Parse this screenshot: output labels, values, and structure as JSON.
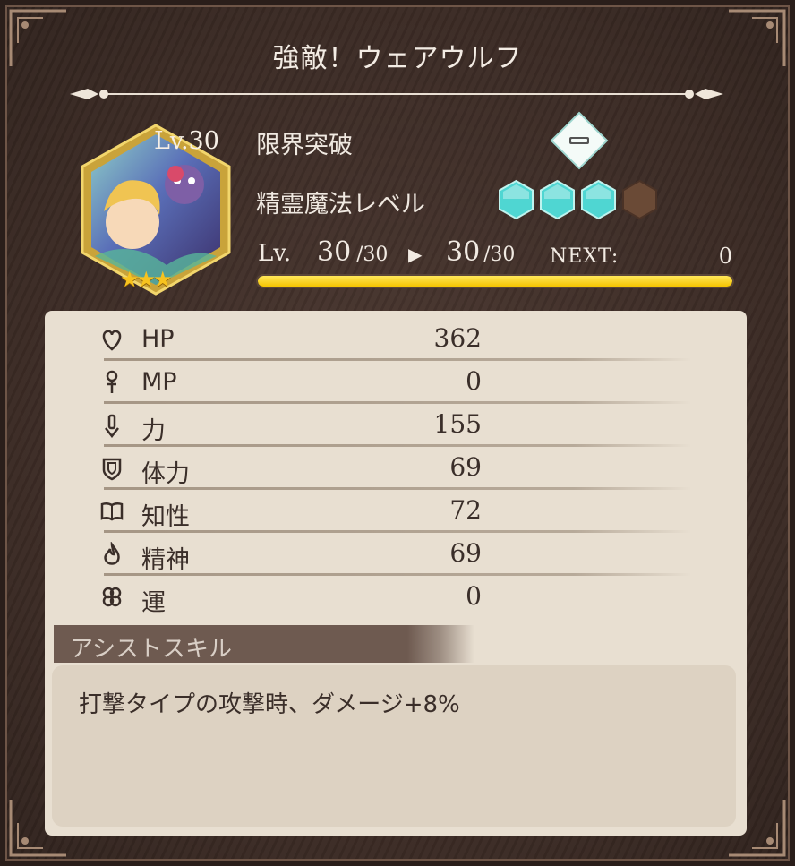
{
  "title": "強敵！ウェアウルフ",
  "character": {
    "level_badge": "Lv.30",
    "stars": "★★★",
    "limit_break_label": "限界突破",
    "limit_break_icon": "minus-diamond-icon",
    "spirit_magic_label": "精霊魔法レベル",
    "spirit_magic_level": 3,
    "spirit_magic_max": 4
  },
  "level": {
    "label": "Lv.",
    "current": "30",
    "current_max": "/30",
    "new": "30",
    "new_max": "/30",
    "next_label": "NEXT:",
    "next_value": "0",
    "progress": 1.0
  },
  "stats": [
    {
      "icon": "heart-icon",
      "name": "HP",
      "value": "362"
    },
    {
      "icon": "mp-staff-icon",
      "name": "MP",
      "value": "0"
    },
    {
      "icon": "power-icon",
      "name": "力",
      "value": "155"
    },
    {
      "icon": "shield-icon",
      "name": "体力",
      "value": "69"
    },
    {
      "icon": "book-icon",
      "name": "知性",
      "value": "72"
    },
    {
      "icon": "spirit-flame-icon",
      "name": "精神",
      "value": "69"
    },
    {
      "icon": "clover-icon",
      "name": "運",
      "value": "0"
    }
  ],
  "assist_skill": {
    "title": "アシストスキル",
    "description": "打撃タイプの攻撃時、ダメージ+8%"
  },
  "colors": {
    "xp_bar": "#f5c400",
    "hex_filled": "#4fd6d2",
    "hex_empty": "#6a4a36",
    "panel": "#e8dfd1"
  }
}
